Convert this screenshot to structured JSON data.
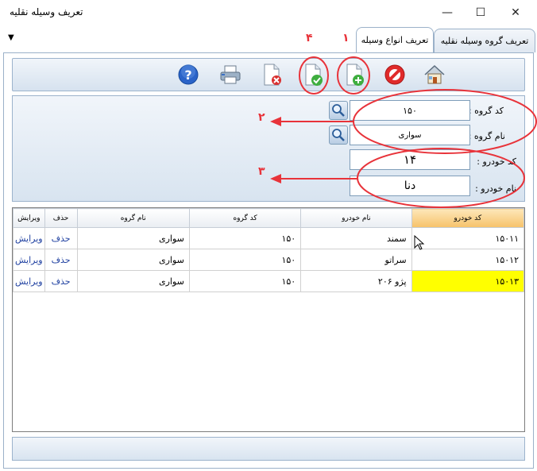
{
  "window": {
    "title": "تعریف وسیله نقلیه",
    "minimize_glyph": "—",
    "maximize_glyph": "☐",
    "close_glyph": "✕"
  },
  "tabs": [
    {
      "label": "تعریف انواع وسیله",
      "active": true
    },
    {
      "label": "تعریف گروه وسیله نقلیه",
      "active": false
    }
  ],
  "dropdown_glyph": "▼",
  "toolbar": {
    "buttons": [
      {
        "name": "help-icon"
      },
      {
        "name": "print-icon"
      },
      {
        "name": "delete-document-icon"
      },
      {
        "name": "confirm-document-icon"
      },
      {
        "name": "add-document-icon"
      },
      {
        "name": "cancel-icon"
      },
      {
        "name": "home-icon"
      }
    ]
  },
  "form": {
    "group_code_label": "کد گروه :",
    "group_code_value": "۱۵۰",
    "group_name_label": "نام گروه :",
    "group_name_value": "سواری",
    "vehicle_code_label": "کد خودرو :",
    "vehicle_code_value": "۱۴",
    "vehicle_name_label": "نام خودرو :",
    "vehicle_name_value": "دنا"
  },
  "grid": {
    "headers": {
      "vehicle_code": "کد خودرو",
      "vehicle_name": "نام خودرو",
      "group_code": "کد گروه",
      "group_name": "نام گروه",
      "delete": "حذف",
      "edit": "ویرایش"
    },
    "rows": [
      {
        "vehicle_code": "۱۵۰۱۱",
        "vehicle_name": "سمند",
        "group_code": "۱۵۰",
        "group_name": "سواری",
        "delete": "حذف",
        "edit": "ویرایش"
      },
      {
        "vehicle_code": "۱۵۰۱۲",
        "vehicle_name": "سراتو",
        "group_code": "۱۵۰",
        "group_name": "سواری",
        "delete": "حذف",
        "edit": "ویرایش"
      },
      {
        "vehicle_code": "۱۵۰۱۳",
        "vehicle_name": "پژو ۲۰۶",
        "group_code": "۱۵۰",
        "group_name": "سواری",
        "delete": "حذف",
        "edit": "ویرایش"
      }
    ]
  },
  "annotations": {
    "n1": "۱",
    "n2": "۲",
    "n3": "۳",
    "n4": "۴",
    "color": "#e8333a"
  }
}
